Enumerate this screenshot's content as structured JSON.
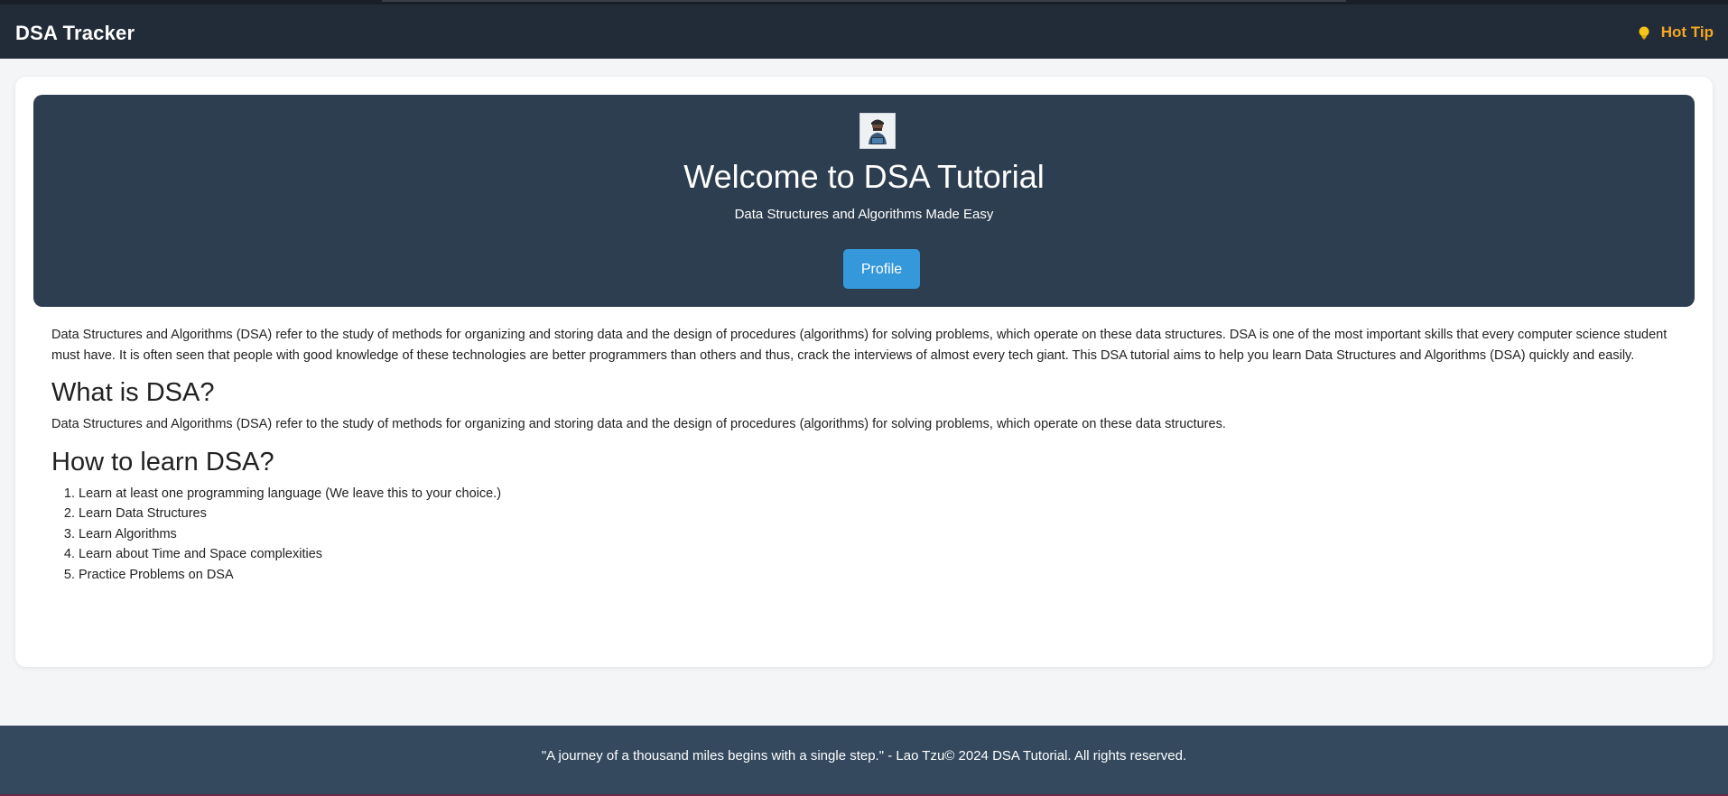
{
  "header": {
    "brand": "DSA Tracker",
    "hot_tip_label": "Hot Tip",
    "hot_tip_icon": "lightbulb-icon"
  },
  "hero": {
    "avatar_icon": "developer-avatar-icon",
    "title": "Welcome to DSA Tutorial",
    "subtitle": "Data Structures and Algorithms Made Easy",
    "profile_button": "Profile"
  },
  "main": {
    "intro": "Data Structures and Algorithms (DSA) refer to the study of methods for organizing and storing data and the design of procedures (algorithms) for solving problems, which operate on these data structures. DSA is one of the most important skills that every computer science student must have. It is often seen that people with good knowledge of these technologies are better programmers than others and thus, crack the interviews of almost every tech giant. This DSA tutorial aims to help you learn Data Structures and Algorithms (DSA) quickly and easily.",
    "what_heading": "What is DSA?",
    "what_text": "Data Structures and Algorithms (DSA) refer to the study of methods for organizing and storing data and the design of procedures (algorithms) for solving problems, which operate on these data structures.",
    "how_heading": "How to learn DSA?",
    "steps": [
      "Learn at least one programming language (We leave this to your choice.)",
      "Learn Data Structures",
      "Learn Algorithms",
      "Learn about Time and Space complexities",
      "Practice Problems on DSA"
    ]
  },
  "footer": {
    "text": "\"A journey of a thousand miles begins with a single step.\" - Lao Tzu© 2024 DSA Tutorial. All rights reserved."
  },
  "colors": {
    "navbar": "#222b38",
    "hero": "#2d3e50",
    "accent": "#3498db",
    "hot_tip": "#f5a623",
    "footer": "#34495e"
  }
}
